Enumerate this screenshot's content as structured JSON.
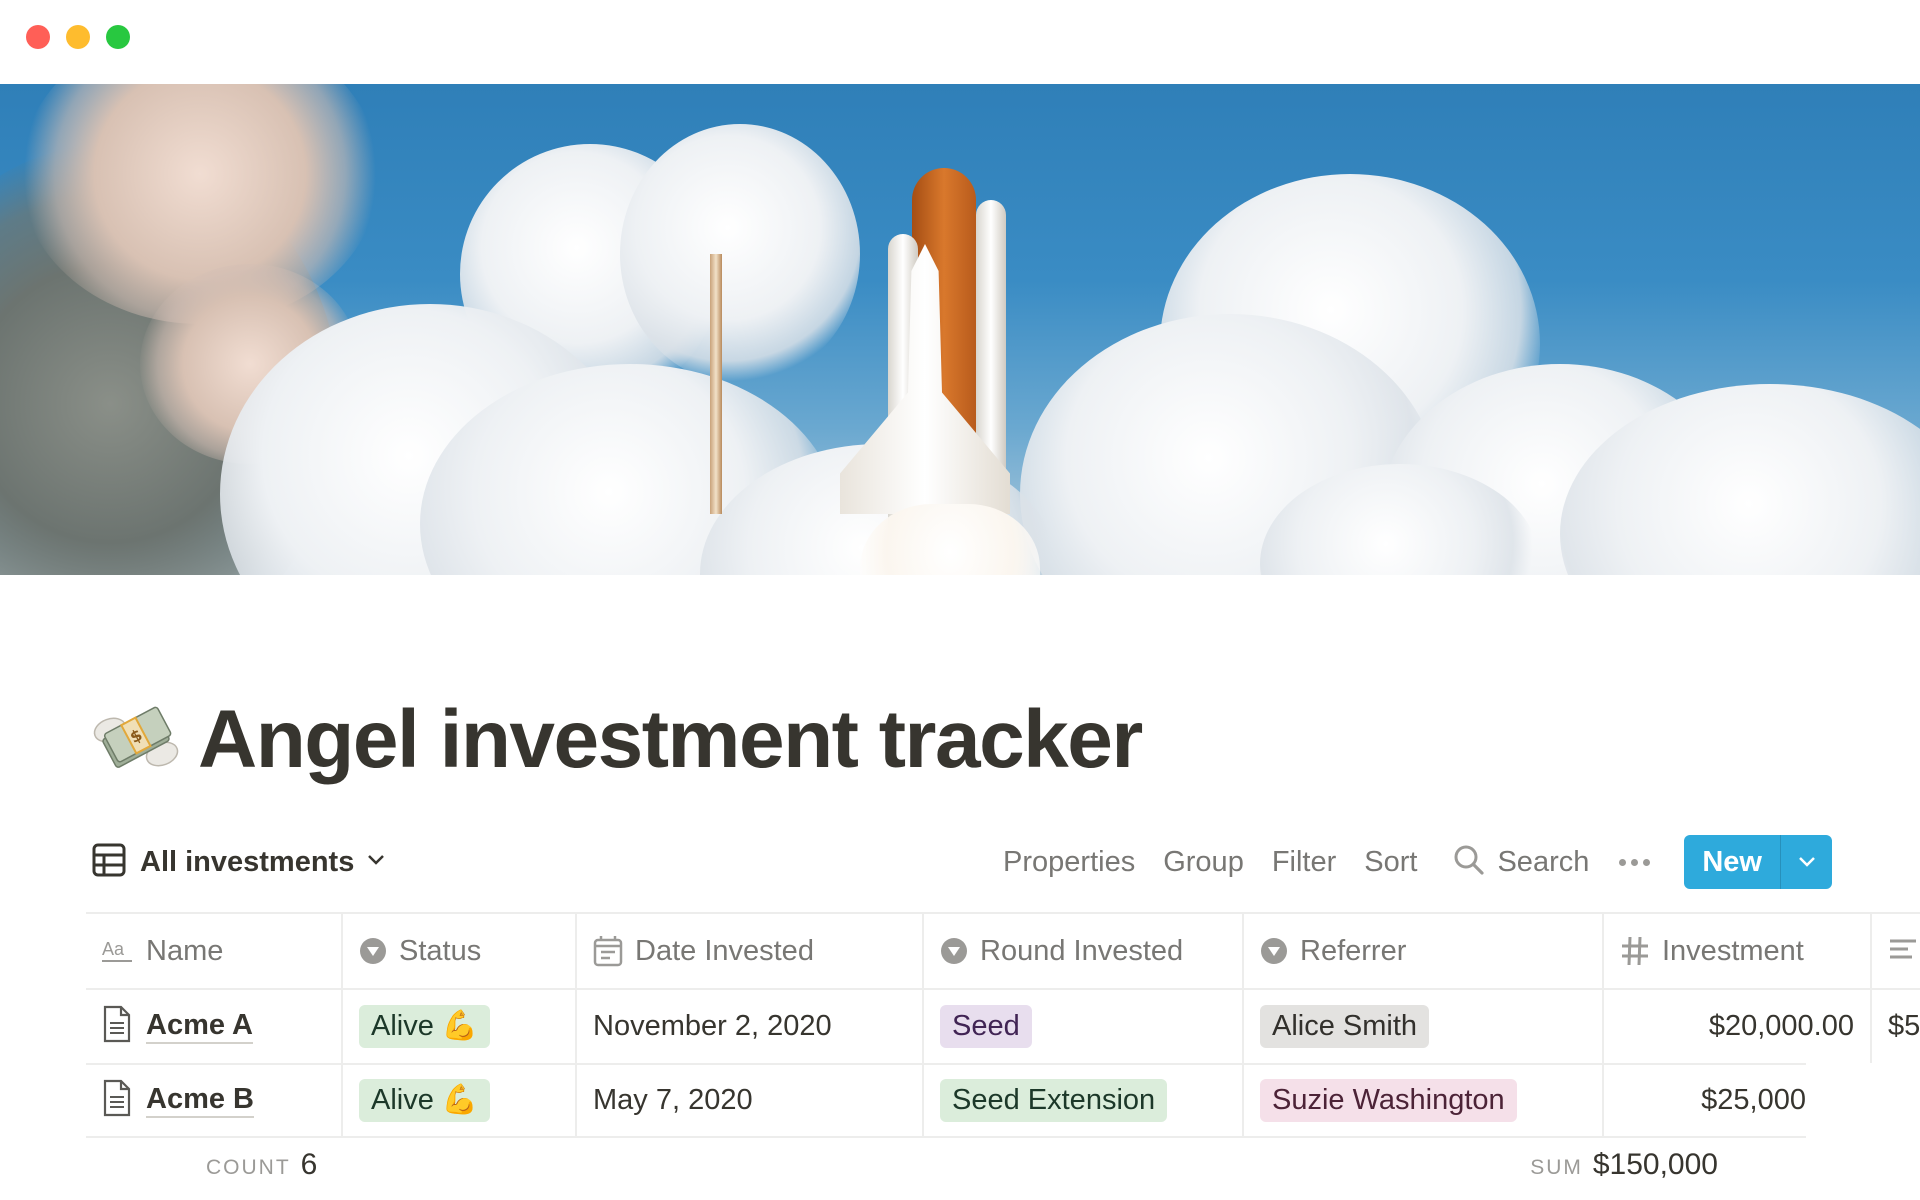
{
  "window": {
    "controls": [
      "close",
      "minimize",
      "zoom"
    ]
  },
  "cover": {
    "description": "Space shuttle launch over clouds"
  },
  "page": {
    "icon": "money-with-wings-emoji",
    "title": "Angel investment tracker"
  },
  "view": {
    "icon": "table-icon",
    "name": "All investments"
  },
  "toolbar": {
    "properties": "Properties",
    "group": "Group",
    "filter": "Filter",
    "sort": "Sort",
    "search": "Search",
    "new": "New"
  },
  "colors": {
    "accent": "#2eaadc",
    "text": "#37352f",
    "muted": "#787774",
    "border": "#ededec"
  },
  "table": {
    "columns": [
      {
        "label": "Name",
        "icon": "text-aa-icon"
      },
      {
        "label": "Status",
        "icon": "select-icon"
      },
      {
        "label": "Date Invested",
        "icon": "calendar-icon"
      },
      {
        "label": "Round Invested",
        "icon": "select-icon"
      },
      {
        "label": "Referrer",
        "icon": "select-icon"
      },
      {
        "label": "Investment",
        "icon": "number-hash-icon"
      },
      {
        "label": "",
        "icon": "text-lines-icon"
      }
    ],
    "rows": [
      {
        "name": "Acme A",
        "status": "Alive 💪",
        "date": "November 2, 2020",
        "round": "Seed",
        "round_color": "purple",
        "referrer": "Alice Smith",
        "referrer_color": "gray",
        "investment": "$20,000.00",
        "extra": "$5"
      },
      {
        "name": "Acme B",
        "status": "Alive 💪",
        "date": "May 7, 2020",
        "round": "Seed Extension",
        "round_color": "green",
        "referrer": "Suzie Washington",
        "referrer_color": "pink",
        "investment": "$25,000",
        "extra": ""
      }
    ]
  },
  "footer": {
    "count_label": "COUNT",
    "count_value": "6",
    "sum_label": "SUM",
    "sum_value": "$150,000"
  }
}
